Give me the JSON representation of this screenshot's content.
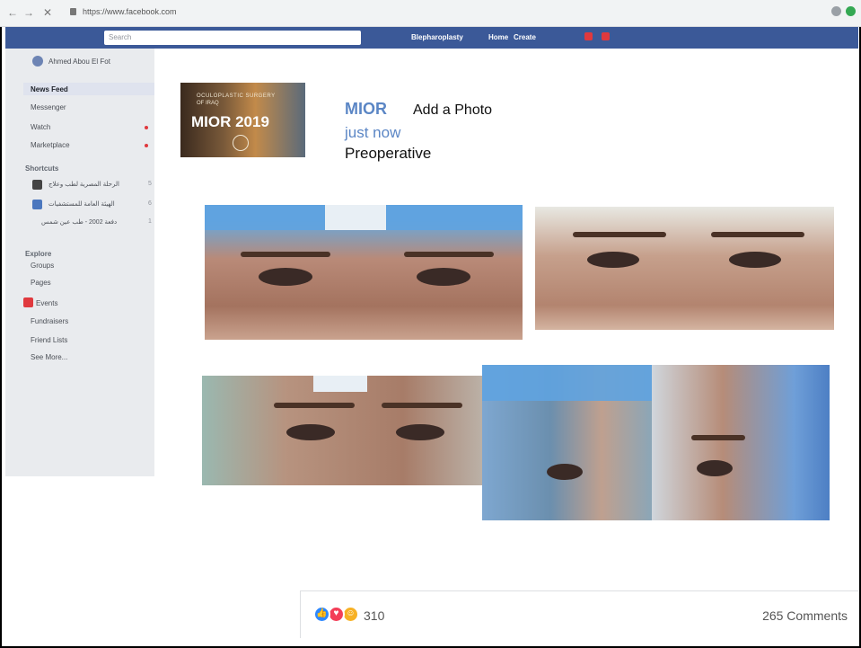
{
  "browser": {
    "url": "https://www.facebook.com",
    "back": "←",
    "forward": "→",
    "close": "✕"
  },
  "fb": {
    "search_placeholder": "Search",
    "page_link": "Blepharoplasty",
    "home": "Home",
    "create": "Create"
  },
  "sidebar": {
    "user": "Ahmed Abou El Fot",
    "items": [
      "News Feed",
      "Messenger",
      "Watch",
      "Marketplace"
    ],
    "shortcuts_header": "Shortcuts",
    "shortcuts": [
      "الرحلة المصرية لطب وعلاج",
      "الهيئة العامة للمستشفيات",
      "دفعة 2002 - طب عين شمس"
    ],
    "explore_header": "Explore",
    "explore": [
      "Groups",
      "Pages",
      "Events",
      "Fundraisers",
      "Friend Lists",
      "See More..."
    ]
  },
  "post": {
    "banner_line1": "OCULOPLASTIC SURGERY",
    "banner_line2": "OF IRAQ",
    "banner_title": "MIOR 2019",
    "author": "MIOR",
    "action": "Add a Photo",
    "time": "just now",
    "caption": "Preoperative"
  },
  "reactions": {
    "count": "310",
    "comments": "265 Comments"
  },
  "colors": {
    "fb_blue": "#3b5998",
    "link_blue": "#5b86c5",
    "like": "#2d88ff",
    "love": "#f33e58",
    "haha": "#f7b125"
  }
}
